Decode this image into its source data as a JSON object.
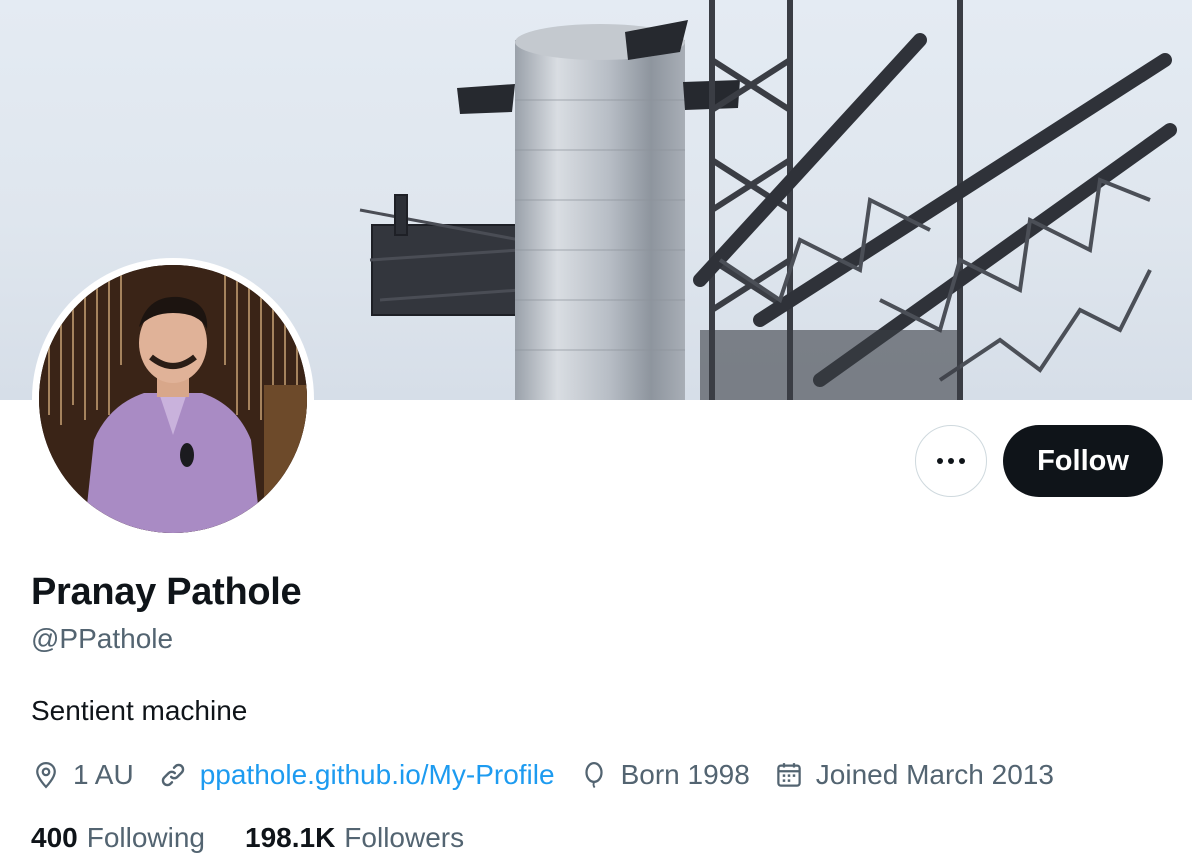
{
  "profile": {
    "display_name": "Pranay Pathole",
    "handle": "@PPathole",
    "bio": "Sentient machine"
  },
  "actions": {
    "more_icon": "more-horizontal-icon",
    "follow_label": "Follow"
  },
  "meta": {
    "location": {
      "icon": "location-pin-icon",
      "text": "1 AU"
    },
    "website": {
      "icon": "link-icon",
      "text": "ppathole.github.io/My-Profile"
    },
    "birthday": {
      "icon": "balloon-icon",
      "text": "Born 1998"
    },
    "joined": {
      "icon": "calendar-icon",
      "text": "Joined March 2013"
    }
  },
  "stats": {
    "following": {
      "count": "400",
      "label": "Following"
    },
    "followers": {
      "count": "198.1K",
      "label": "Followers"
    }
  },
  "colors": {
    "accent_link": "#1d9bf0",
    "text_primary": "#0f1419",
    "text_secondary": "#536471",
    "follow_button_bg": "#0f1419"
  }
}
